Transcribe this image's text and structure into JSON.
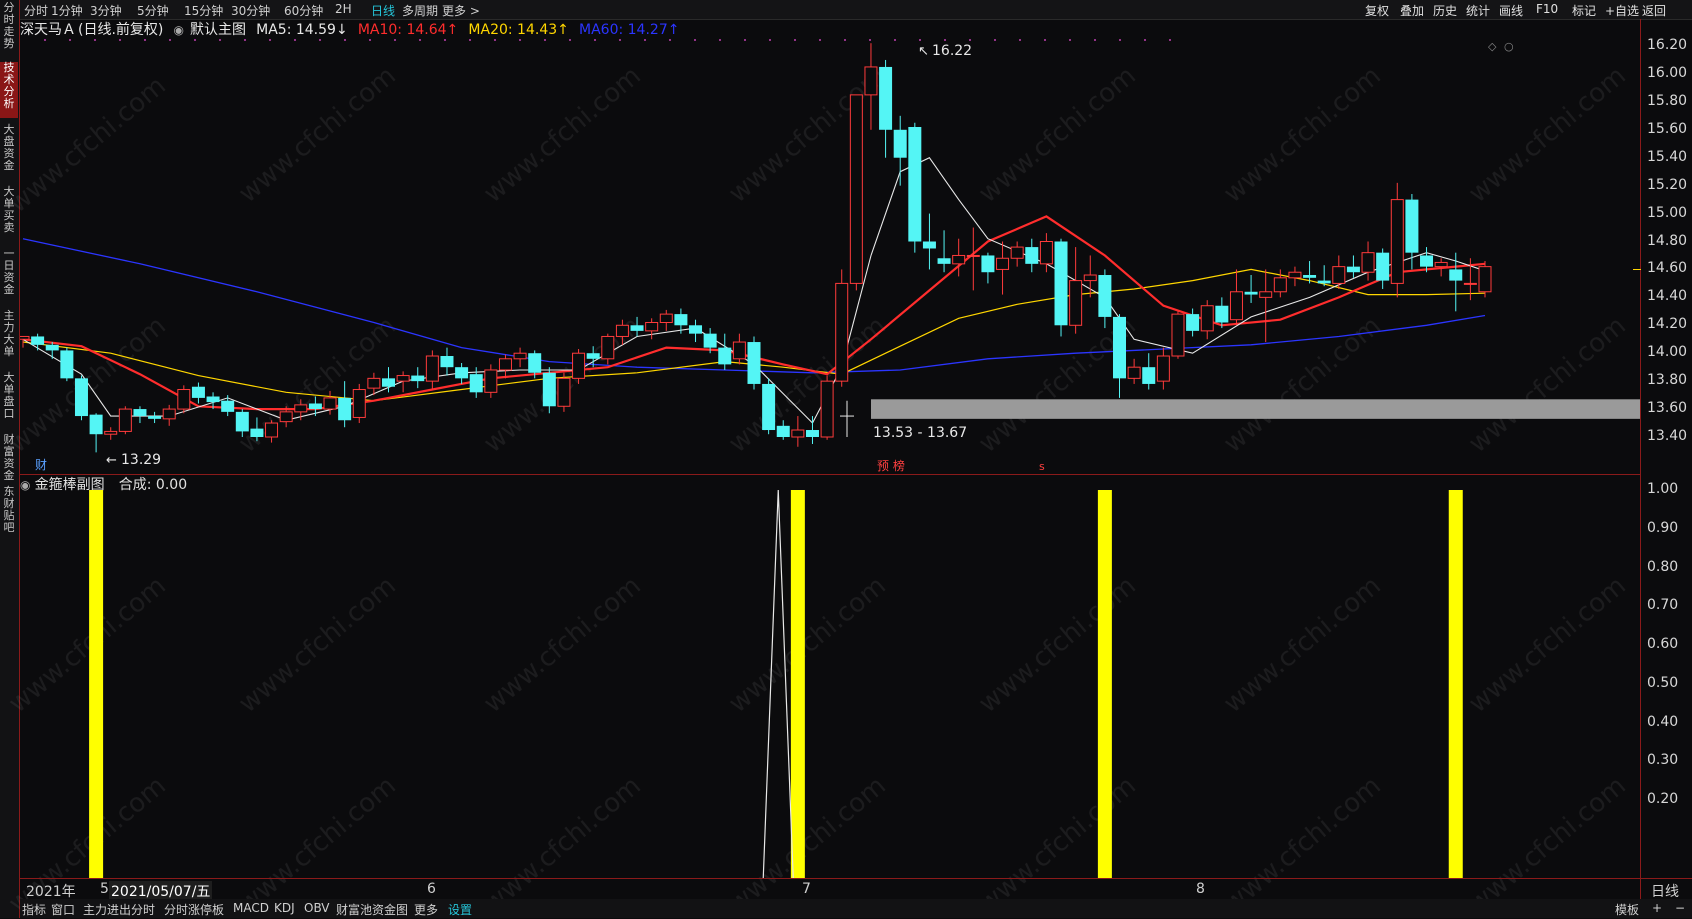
{
  "toolbar": {
    "left_items": [
      "分时",
      "1分钟",
      "3分钟",
      "5分钟",
      "15分钟",
      "30分钟",
      "60分钟",
      "2H",
      "日线",
      "多周期",
      "更多 >"
    ],
    "active_item": "日线",
    "right_items": [
      "复权",
      "叠加",
      "历史",
      "统计",
      "画线",
      "F10",
      "标记",
      "+自选",
      "返回"
    ]
  },
  "left_tabs": [
    "分时走势",
    "技术分析",
    "大盘资金",
    "大单买卖",
    "一日资金",
    "主力大单",
    "大单盘口",
    "财富资金",
    "东财贴吧"
  ],
  "active_left_tab": "技术分析",
  "header": {
    "stock": "深天马Ａ",
    "mode": "(日线.前复权)",
    "chart_name": "默认主图",
    "ma5": "MA5: 14.59↓",
    "ma10": "MA10: 14.64↑",
    "ma20": "MA20: 14.43↑",
    "ma60": "MA60: 14.27↑",
    "colors": {
      "ma5": "#e8e8e8",
      "ma10": "#ff2d2d",
      "ma20": "#ffd600",
      "ma60": "#2b35ff"
    }
  },
  "sub_header": {
    "name": "金箍棒副图",
    "value": "合成: 0.00"
  },
  "annotations": {
    "high": "16.22",
    "low": "13.29",
    "range": "13.53 - 13.67",
    "fin_marker": "财",
    "event_markers": "预 榜",
    "s_marker": "s"
  },
  "price_axis": [
    "16.20",
    "16.00",
    "15.80",
    "15.60",
    "15.40",
    "15.20",
    "15.00",
    "14.80",
    "14.60",
    "14.40",
    "14.20",
    "14.00",
    "13.80",
    "13.60",
    "13.40"
  ],
  "ind_axis": [
    "1.00",
    "0.90",
    "0.80",
    "0.70",
    "0.60",
    "0.50",
    "0.40",
    "0.30",
    "0.20"
  ],
  "date_axis": {
    "year": "2021年",
    "m5": "5",
    "cursor_date": "2021/05/07/五",
    "m6": "6",
    "m7": "7",
    "m8": "8",
    "period": "日线"
  },
  "bottom_tabs": [
    "指标",
    "窗口",
    "主力进出分时",
    "分时涨停板",
    "MACD",
    "KDJ",
    "OBV",
    "财富池资金图",
    "更多",
    "设置"
  ],
  "bottom_active": "设置",
  "bottom_right": [
    "模板",
    "+",
    "−"
  ],
  "watermark": "www.cfchi.com",
  "chart_data": {
    "type": "candlestick",
    "title": "深天马Ａ (日线.前复权)",
    "ylim": [
      13.3,
      16.25
    ],
    "x_months": [
      "5",
      "6",
      "7",
      "8"
    ],
    "candles": [
      [
        14.1,
        14.12,
        14.04,
        14.1
      ],
      [
        14.12,
        14.06,
        14.02,
        14.14
      ],
      [
        14.06,
        14.02,
        13.96,
        14.08
      ],
      [
        14.02,
        13.82,
        13.8,
        14.04
      ],
      [
        13.82,
        13.55,
        13.52,
        13.84
      ],
      [
        13.56,
        13.42,
        13.29,
        13.57
      ],
      [
        13.42,
        13.44,
        13.38,
        13.47
      ],
      [
        13.44,
        13.6,
        13.42,
        13.62
      ],
      [
        13.6,
        13.55,
        13.5,
        13.62
      ],
      [
        13.55,
        13.53,
        13.5,
        13.58
      ],
      [
        13.53,
        13.6,
        13.48,
        13.63
      ],
      [
        13.6,
        13.74,
        13.57,
        13.77
      ],
      [
        13.76,
        13.68,
        13.64,
        13.79
      ],
      [
        13.69,
        13.65,
        13.6,
        13.72
      ],
      [
        13.66,
        13.58,
        13.55,
        13.7
      ],
      [
        13.58,
        13.44,
        13.4,
        13.6
      ],
      [
        13.46,
        13.4,
        13.37,
        13.54
      ],
      [
        13.4,
        13.5,
        13.36,
        13.52
      ],
      [
        13.51,
        13.58,
        13.47,
        13.62
      ],
      [
        13.58,
        13.63,
        13.52,
        13.67
      ],
      [
        13.64,
        13.6,
        13.55,
        13.69
      ],
      [
        13.6,
        13.68,
        13.56,
        13.73
      ],
      [
        13.68,
        13.52,
        13.47,
        13.8
      ],
      [
        13.54,
        13.74,
        13.5,
        13.78
      ],
      [
        13.75,
        13.82,
        13.7,
        13.86
      ],
      [
        13.82,
        13.76,
        13.72,
        13.9
      ],
      [
        13.8,
        13.84,
        13.72,
        13.87
      ],
      [
        13.84,
        13.8,
        13.75,
        13.9
      ],
      [
        13.8,
        13.98,
        13.74,
        14.02
      ],
      [
        13.98,
        13.9,
        13.84,
        14.04
      ],
      [
        13.9,
        13.82,
        13.78,
        13.93
      ],
      [
        13.85,
        13.72,
        13.68,
        13.9
      ],
      [
        13.72,
        13.88,
        13.68,
        13.92
      ],
      [
        13.88,
        13.96,
        13.82,
        13.99
      ],
      [
        13.96,
        14.0,
        13.9,
        14.04
      ],
      [
        14.0,
        13.86,
        13.82,
        14.02
      ],
      [
        13.86,
        13.62,
        13.57,
        13.9
      ],
      [
        13.62,
        13.82,
        13.58,
        13.86
      ],
      [
        13.82,
        14.0,
        13.78,
        14.03
      ],
      [
        14.0,
        13.96,
        13.9,
        14.05
      ],
      [
        13.96,
        14.12,
        13.92,
        14.14
      ],
      [
        14.12,
        14.2,
        14.06,
        14.24
      ],
      [
        14.2,
        14.16,
        14.12,
        14.26
      ],
      [
        14.16,
        14.22,
        14.1,
        14.25
      ],
      [
        14.22,
        14.28,
        14.16,
        14.31
      ],
      [
        14.28,
        14.2,
        14.14,
        14.32
      ],
      [
        14.2,
        14.14,
        14.08,
        14.24
      ],
      [
        14.14,
        14.04,
        14.0,
        14.18
      ],
      [
        14.04,
        13.92,
        13.88,
        14.14
      ],
      [
        13.96,
        14.08,
        13.92,
        14.14
      ],
      [
        14.08,
        13.78,
        13.74,
        14.12
      ],
      [
        13.78,
        13.45,
        13.42,
        13.82
      ],
      [
        13.48,
        13.4,
        13.38,
        13.52
      ],
      [
        13.4,
        13.45,
        13.33,
        13.55
      ],
      [
        13.45,
        13.4,
        13.35,
        13.55
      ],
      [
        13.4,
        13.8,
        13.38,
        13.84
      ],
      [
        13.8,
        14.5,
        13.76,
        14.6
      ],
      [
        14.5,
        15.85,
        14.45,
        15.85
      ],
      [
        15.85,
        16.05,
        15.6,
        16.22
      ],
      [
        16.05,
        15.6,
        15.4,
        16.1
      ],
      [
        15.6,
        15.4,
        15.2,
        15.7
      ],
      [
        15.62,
        14.8,
        14.72,
        15.65
      ],
      [
        14.8,
        14.75,
        14.6,
        15.0
      ],
      [
        14.68,
        14.64,
        14.58,
        14.88
      ],
      [
        14.64,
        14.7,
        14.55,
        14.82
      ],
      [
        14.7,
        14.7,
        14.45,
        14.9
      ],
      [
        14.7,
        14.58,
        14.5,
        14.72
      ],
      [
        14.6,
        14.68,
        14.42,
        14.8
      ],
      [
        14.68,
        14.76,
        14.62,
        14.8
      ],
      [
        14.76,
        14.64,
        14.58,
        14.82
      ],
      [
        14.64,
        14.8,
        14.58,
        14.86
      ],
      [
        14.8,
        14.2,
        14.12,
        14.82
      ],
      [
        14.2,
        14.52,
        14.14,
        14.76
      ],
      [
        14.52,
        14.56,
        14.4,
        14.7
      ],
      [
        14.56,
        14.26,
        14.18,
        14.6
      ],
      [
        14.26,
        13.82,
        13.68,
        14.28
      ],
      [
        13.82,
        13.9,
        13.78,
        13.96
      ],
      [
        13.9,
        13.78,
        13.74,
        14.0
      ],
      [
        13.8,
        13.98,
        13.74,
        14.04
      ],
      [
        13.98,
        14.28,
        13.96,
        14.3
      ],
      [
        14.28,
        14.16,
        14.12,
        14.32
      ],
      [
        14.16,
        14.34,
        14.1,
        14.38
      ],
      [
        14.34,
        14.22,
        14.18,
        14.4
      ],
      [
        14.24,
        14.44,
        14.2,
        14.6
      ],
      [
        14.44,
        14.42,
        14.36,
        14.56
      ],
      [
        14.4,
        14.44,
        14.08,
        14.6
      ],
      [
        14.44,
        14.54,
        14.4,
        14.6
      ],
      [
        14.54,
        14.58,
        14.48,
        14.62
      ],
      [
        14.56,
        14.54,
        14.5,
        14.66
      ],
      [
        14.52,
        14.5,
        14.48,
        14.63
      ],
      [
        14.5,
        14.62,
        14.46,
        14.7
      ],
      [
        14.62,
        14.58,
        14.54,
        14.7
      ],
      [
        14.58,
        14.72,
        14.52,
        14.8
      ],
      [
        14.72,
        14.52,
        14.46,
        14.75
      ],
      [
        14.5,
        15.1,
        14.4,
        15.22
      ],
      [
        15.1,
        14.72,
        14.6,
        15.14
      ],
      [
        14.7,
        14.62,
        14.58,
        14.76
      ],
      [
        14.62,
        14.65,
        14.55,
        14.68
      ],
      [
        14.6,
        14.52,
        14.3,
        14.72
      ],
      [
        14.5,
        14.5,
        14.38,
        14.68
      ],
      [
        14.44,
        14.62,
        14.4,
        14.66
      ]
    ],
    "ma5": [
      [
        0,
        14.1
      ],
      [
        4,
        13.85
      ],
      [
        6,
        13.55
      ],
      [
        10,
        13.55
      ],
      [
        14,
        13.68
      ],
      [
        18,
        13.52
      ],
      [
        22,
        13.62
      ],
      [
        26,
        13.8
      ],
      [
        30,
        13.86
      ],
      [
        34,
        13.88
      ],
      [
        38,
        13.88
      ],
      [
        42,
        14.12
      ],
      [
        46,
        14.18
      ],
      [
        50,
        13.92
      ],
      [
        54,
        13.5
      ],
      [
        56,
        13.9
      ],
      [
        58,
        14.7
      ],
      [
        60,
        15.3
      ],
      [
        62,
        15.4
      ],
      [
        64,
        15.1
      ],
      [
        66,
        14.82
      ],
      [
        70,
        14.64
      ],
      [
        74,
        14.4
      ],
      [
        76,
        14.1
      ],
      [
        80,
        14.0
      ],
      [
        84,
        14.26
      ],
      [
        88,
        14.4
      ],
      [
        92,
        14.58
      ],
      [
        96,
        14.72
      ],
      [
        98,
        14.66
      ],
      [
        100,
        14.59
      ]
    ],
    "ma10": [
      [
        0,
        14.1
      ],
      [
        4,
        14.05
      ],
      [
        8,
        13.85
      ],
      [
        12,
        13.62
      ],
      [
        16,
        13.6
      ],
      [
        20,
        13.6
      ],
      [
        24,
        13.66
      ],
      [
        28,
        13.74
      ],
      [
        32,
        13.82
      ],
      [
        36,
        13.86
      ],
      [
        40,
        13.9
      ],
      [
        44,
        14.04
      ],
      [
        48,
        14.02
      ],
      [
        52,
        13.92
      ],
      [
        55,
        13.85
      ],
      [
        58,
        14.1
      ],
      [
        62,
        14.45
      ],
      [
        66,
        14.8
      ],
      [
        70,
        14.98
      ],
      [
        74,
        14.7
      ],
      [
        78,
        14.34
      ],
      [
        82,
        14.2
      ],
      [
        86,
        14.24
      ],
      [
        90,
        14.4
      ],
      [
        94,
        14.58
      ],
      [
        98,
        14.62
      ],
      [
        100,
        14.64
      ]
    ],
    "ma20": [
      [
        0,
        14.08
      ],
      [
        6,
        14.0
      ],
      [
        12,
        13.84
      ],
      [
        18,
        13.72
      ],
      [
        24,
        13.66
      ],
      [
        30,
        13.74
      ],
      [
        36,
        13.82
      ],
      [
        42,
        13.86
      ],
      [
        48,
        13.94
      ],
      [
        52,
        13.9
      ],
      [
        56,
        13.85
      ],
      [
        60,
        14.05
      ],
      [
        64,
        14.25
      ],
      [
        68,
        14.35
      ],
      [
        72,
        14.42
      ],
      [
        76,
        14.46
      ],
      [
        80,
        14.52
      ],
      [
        84,
        14.6
      ],
      [
        88,
        14.52
      ],
      [
        92,
        14.42
      ],
      [
        96,
        14.42
      ],
      [
        100,
        14.43
      ]
    ],
    "ma60": [
      [
        0,
        14.82
      ],
      [
        8,
        14.64
      ],
      [
        16,
        14.44
      ],
      [
        24,
        14.22
      ],
      [
        30,
        14.04
      ],
      [
        36,
        13.94
      ],
      [
        42,
        13.9
      ],
      [
        48,
        13.88
      ],
      [
        54,
        13.86
      ],
      [
        60,
        13.88
      ],
      [
        66,
        13.96
      ],
      [
        72,
        14.0
      ],
      [
        78,
        14.03
      ],
      [
        84,
        14.06
      ],
      [
        90,
        14.12
      ],
      [
        96,
        14.2
      ],
      [
        100,
        14.27
      ]
    ],
    "indicator": {
      "name": "金箍棒副图",
      "bars_at": [
        5,
        53,
        74,
        98
      ],
      "spike_at": 52,
      "ylim": [
        0,
        1
      ]
    }
  }
}
